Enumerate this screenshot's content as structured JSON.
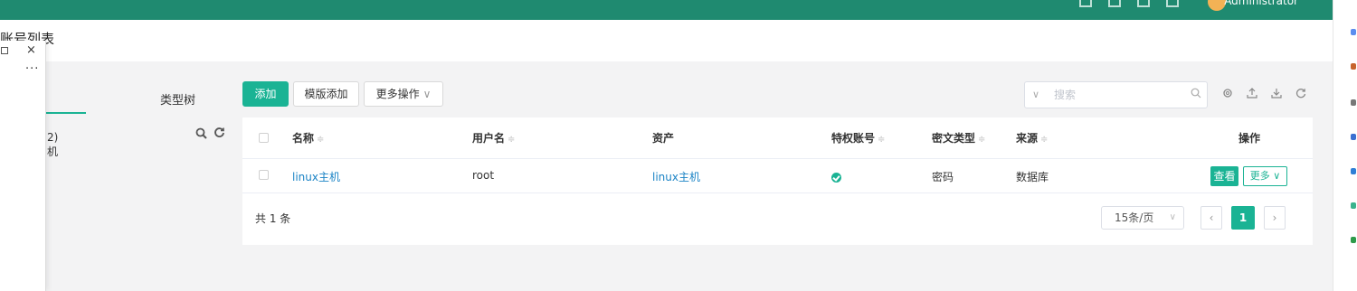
{
  "header": {
    "user": "Administrator",
    "title": "账号列表"
  },
  "popup": {
    "restore": "□",
    "close": "×",
    "more": "···"
  },
  "left_panel": {
    "tab_type_tree": "类型树",
    "tree_count_fragment": "2)",
    "tree_item_fragment": "机"
  },
  "toolbar": {
    "add_label": "添加",
    "template_add_label": "模版添加",
    "more_actions_label": "更多操作",
    "search_placeholder": "搜索"
  },
  "table": {
    "columns": [
      "名称",
      "用户名",
      "资产",
      "特权账号",
      "密文类型",
      "来源",
      "操作"
    ],
    "rows": [
      {
        "name": "linux主机",
        "username": "root",
        "asset": "linux主机",
        "privileged": true,
        "secret_type": "密码",
        "source": "数据库"
      }
    ],
    "view_label": "查看",
    "more_label": "更多"
  },
  "pagination": {
    "total_text": "共 1 条",
    "page_size": "15条/页",
    "current_page": "1"
  },
  "colors": {
    "topbar": "#1f8a70",
    "primary": "#1ab394",
    "link": "#1c84c6"
  },
  "icons": [
    "chevron-down-icon",
    "search-icon",
    "settings-icon",
    "upload-icon",
    "download-icon",
    "refresh-icon",
    "check-circle-icon"
  ]
}
